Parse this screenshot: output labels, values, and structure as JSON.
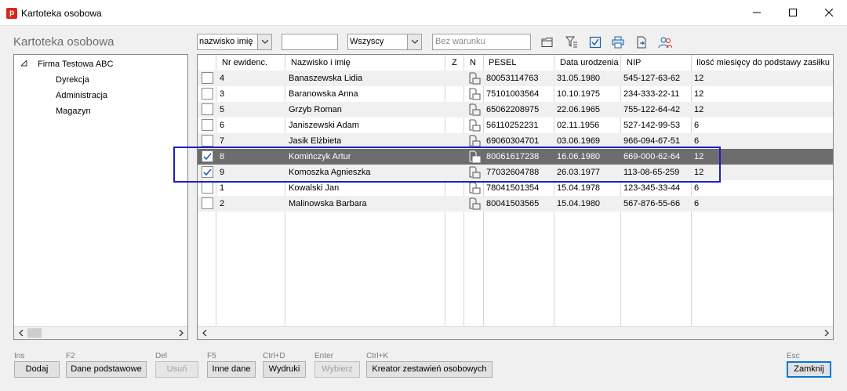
{
  "window": {
    "title": "Kartoteka osobowa",
    "app_icon_letter": "p"
  },
  "header": {
    "title": "Kartoteka osobowa"
  },
  "toolbar": {
    "sort_combo": "nazwisko imię",
    "search_value": "",
    "filter_combo": "Wszyscy",
    "condition_placeholder": "Bez warunku"
  },
  "tree": {
    "root": "Firma Testowa ABC",
    "children": [
      "Dyrekcja",
      "Administracja",
      "Magazyn"
    ]
  },
  "grid": {
    "columns": [
      "Nr ewidenc.",
      "Nazwisko i imię",
      "Z",
      "N",
      "PESEL",
      "Data urodzenia",
      "NIP",
      "Ilość miesięcy do podstawy zasiłku"
    ],
    "rows": [
      {
        "nr": "4",
        "name": "Banaszewska Lidia",
        "pesel": "80053114763",
        "birth": "31.05.1980",
        "nip": "545-127-63-62",
        "months": "12",
        "checked": false,
        "selected": false
      },
      {
        "nr": "3",
        "name": "Baranowska Anna",
        "pesel": "75101003564",
        "birth": "10.10.1975",
        "nip": "234-333-22-11",
        "months": "12",
        "checked": false,
        "selected": false
      },
      {
        "nr": "5",
        "name": "Grzyb Roman",
        "pesel": "65062208975",
        "birth": "22.06.1965",
        "nip": "755-122-64-42",
        "months": "12",
        "checked": false,
        "selected": false
      },
      {
        "nr": "6",
        "name": "Janiszewski Adam",
        "pesel": "56110252231",
        "birth": "02.11.1956",
        "nip": "527-142-99-53",
        "months": "6",
        "checked": false,
        "selected": false
      },
      {
        "nr": "7",
        "name": "Jasik Elżbieta",
        "pesel": "69060304701",
        "birth": "03.06.1969",
        "nip": "966-094-67-51",
        "months": "6",
        "checked": false,
        "selected": false
      },
      {
        "nr": "8",
        "name": "Komińczyk Artur",
        "pesel": "80061617238",
        "birth": "16.06.1980",
        "nip": "669-000-62-64",
        "months": "12",
        "checked": true,
        "selected": true
      },
      {
        "nr": "9",
        "name": "Komoszka Agnieszka",
        "pesel": "77032604788",
        "birth": "26.03.1977",
        "nip": "113-08-65-259",
        "months": "12",
        "checked": true,
        "selected": false
      },
      {
        "nr": "1",
        "name": "Kowalski Jan",
        "pesel": "78041501354",
        "birth": "15.04.1978",
        "nip": "123-345-33-44",
        "months": "6",
        "checked": false,
        "selected": false
      },
      {
        "nr": "2",
        "name": "Malinowska Barbara",
        "pesel": "80041503565",
        "birth": "15.04.1980",
        "nip": "567-876-55-66",
        "months": "6",
        "checked": false,
        "selected": false
      }
    ]
  },
  "buttons": [
    {
      "hotkey": "Ins",
      "label": "Dodaj",
      "disabled": false
    },
    {
      "hotkey": "F2",
      "label": "Dane podstawowe",
      "disabled": false
    },
    {
      "hotkey": "Del",
      "label": "Usuń",
      "disabled": true
    },
    {
      "hotkey": "F5",
      "label": "Inne dane",
      "disabled": false
    },
    {
      "hotkey": "Ctrl+D",
      "label": "Wydruki",
      "disabled": false
    },
    {
      "hotkey": "Enter",
      "label": "Wybierz",
      "disabled": true
    },
    {
      "hotkey": "Ctrl+K",
      "label": "Kreator zestawień osobowych",
      "disabled": false
    },
    {
      "hotkey": "Esc",
      "label": "Zamknij",
      "disabled": false
    }
  ],
  "icons": {
    "toolbar": [
      "folder-icon",
      "filter-icon",
      "checkbox-icon",
      "printer-icon",
      "export-icon",
      "users-icon"
    ],
    "accent": "#1f1fbf",
    "selection": "#6d6d6d"
  }
}
